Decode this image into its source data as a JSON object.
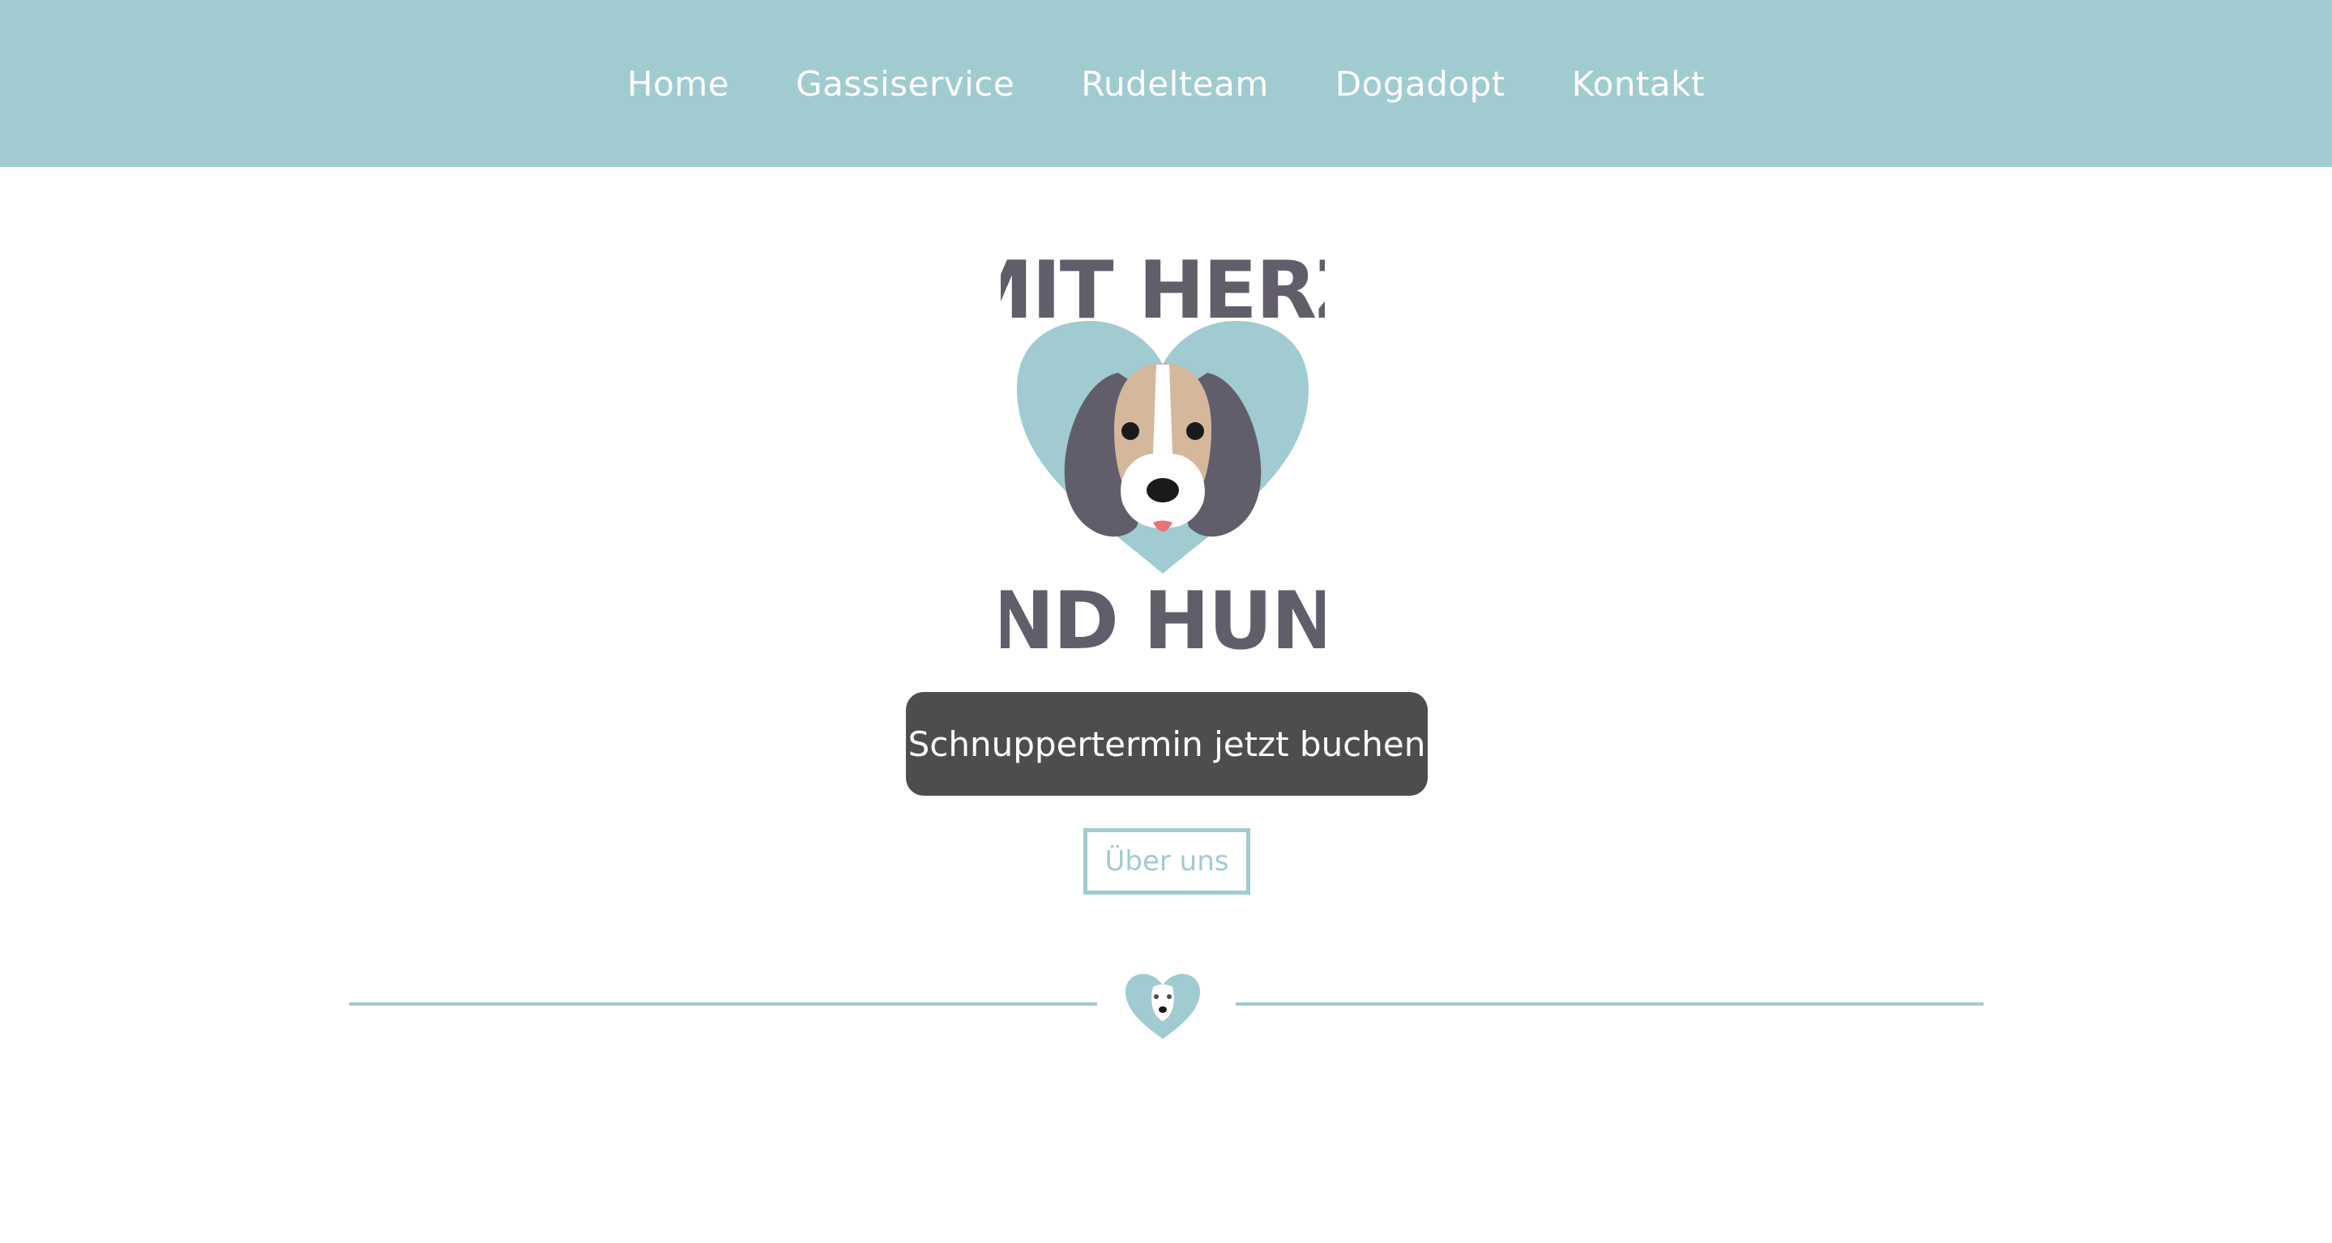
{
  "nav": {
    "items": [
      {
        "label": "Home"
      },
      {
        "label": "Gassiservice"
      },
      {
        "label": "Rudelteam"
      },
      {
        "label": "Dogadopt"
      },
      {
        "label": "Kontakt"
      }
    ]
  },
  "logo": {
    "line1": "MIT HERZ",
    "line2": "UND HUND",
    "icon": "dog-heart-icon"
  },
  "cta": {
    "label": "Schnuppertermin jetzt buchen"
  },
  "about": {
    "label": "Über uns"
  },
  "divider": {
    "icon": "dog-heart-small-icon"
  },
  "colors": {
    "accent": "#a0cbd1",
    "dark": "#4d4d4d",
    "logo_text": "#625d6b",
    "white": "#ffffff"
  }
}
